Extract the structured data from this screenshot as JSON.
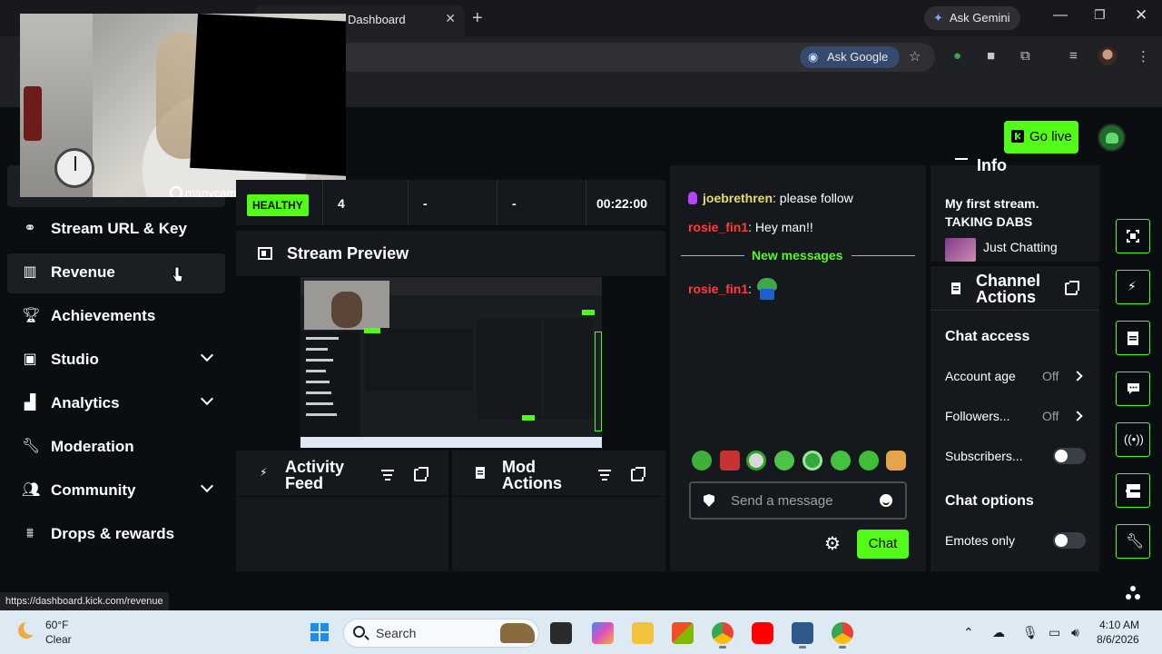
{
  "browser": {
    "tab_title": "Dashboard",
    "gemini_label": "Ask Gemini",
    "ask_google_label": "Ask Google",
    "status_url": "https://dashboard.kick.com/revenue"
  },
  "header": {
    "go_live_label": "Go live"
  },
  "webcam": {
    "watermark": "manycam"
  },
  "sidebar": {
    "items": [
      {
        "label": "Stream URL & Key",
        "icon": "link-icon"
      },
      {
        "label": "Revenue",
        "icon": "bar-chart-icon"
      },
      {
        "label": "Achievements",
        "icon": "trophy-icon"
      },
      {
        "label": "Studio",
        "icon": "film-icon",
        "expandable": true
      },
      {
        "label": "Analytics",
        "icon": "analytics-icon",
        "expandable": true
      },
      {
        "label": "Moderation",
        "icon": "wrench-icon"
      },
      {
        "label": "Community",
        "icon": "people-icon",
        "expandable": true
      },
      {
        "label": "Drops & rewards",
        "icon": "gift-icon"
      }
    ]
  },
  "stats": {
    "health": "HEALTHY",
    "viewers": "4",
    "stat_3": "-",
    "stat_4": "-",
    "duration": "00:22:00"
  },
  "stream_preview": {
    "title": "Stream Preview"
  },
  "activity_feed": {
    "title_line1": "Activity",
    "title_line2": "Feed"
  },
  "mod_actions": {
    "title_line1": "Mod",
    "title_line2": "Actions"
  },
  "chat": {
    "messages": [
      {
        "user": "joebrethren",
        "text": ": please follow"
      },
      {
        "user": "rosie_fin1",
        "text": ": Hey man!!"
      },
      {
        "user": "rosie_fin1",
        "text": ":"
      }
    ],
    "new_messages_label": "New messages",
    "input_placeholder": "Send a message",
    "send_label": "Chat"
  },
  "stream_info": {
    "title": "Info",
    "stream_title_line1": "My first stream.",
    "stream_title_line2": "TAKING DABS",
    "category": "Just Chatting"
  },
  "channel_actions": {
    "title_line1": "Channel",
    "title_line2": "Actions",
    "chat_access_heading": "Chat access",
    "account_age_label": "Account age",
    "account_age_value": "Off",
    "followers_label": "Followers...",
    "followers_value": "Off",
    "subscribers_label": "Subscribers...",
    "subscribers_enabled": false,
    "chat_options_heading": "Chat options",
    "emotes_only_label": "Emotes only",
    "emotes_only_enabled": false
  },
  "taskbar": {
    "weather_temp": "60°F",
    "weather_desc": "Clear",
    "search_label": "Search",
    "time": "4:10 AM",
    "date": "8/6/2026"
  },
  "colors": {
    "kick_green": "#53fc18",
    "panel_bg": "#15191d",
    "page_bg": "#0b0e11"
  }
}
